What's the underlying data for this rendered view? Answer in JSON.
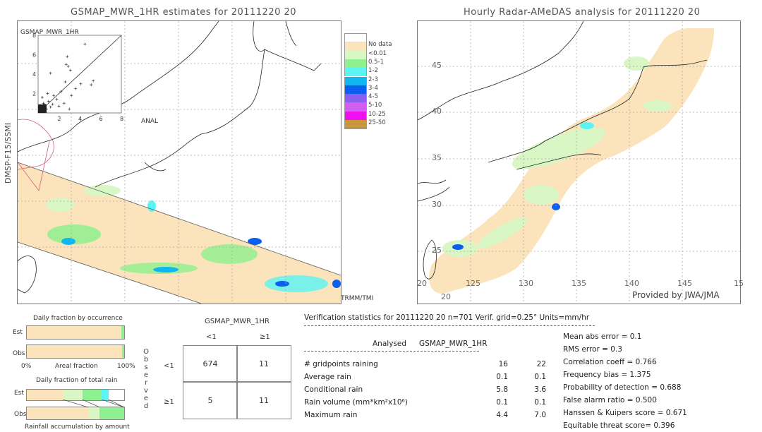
{
  "left_panel": {
    "title": "GSMAP_MWR_1HR estimates for 20111220 20",
    "y_axis_label": "DMSP-F15/SSMI",
    "inset_title": "GSMAP_MWR_1HR",
    "inset_x_label": "ANAL",
    "inset_ticks": [
      "2",
      "4",
      "6",
      "8"
    ],
    "swath_label": "TRMM/TMI"
  },
  "right_panel": {
    "title": "Hourly Radar-AMeDAS analysis for 20111220 20",
    "lat_ticks": [
      "45",
      "40",
      "35",
      "30",
      "25",
      "20"
    ],
    "lon_ticks": [
      "20",
      "125",
      "130",
      "135",
      "140",
      "145",
      "15"
    ],
    "credit": "Provided by JWA/JMA"
  },
  "legend": {
    "items": [
      {
        "label": "",
        "color": "#ffffff"
      },
      {
        "label": "No data",
        "color": "#fbe3bb"
      },
      {
        "label": "<0.01",
        "color": "#d8f7c4"
      },
      {
        "label": "0.5-1",
        "color": "#8ef08e"
      },
      {
        "label": "1-2",
        "color": "#5af4f4"
      },
      {
        "label": "2-3",
        "color": "#0fb6f2"
      },
      {
        "label": "3-4",
        "color": "#0a5ff0"
      },
      {
        "label": "4-5",
        "color": "#8a5ef0"
      },
      {
        "label": "5-10",
        "color": "#d35ff0"
      },
      {
        "label": "10-25",
        "color": "#f00ff0"
      },
      {
        "label": "25-50",
        "color": "#c8963c"
      }
    ]
  },
  "occurrence": {
    "title": "Daily fraction by occurrence",
    "est_label": "Est",
    "obs_label": "Obs",
    "axis_left": "0%",
    "axis_mid": "Areal fraction",
    "axis_right": "100%",
    "est_fractions": [
      0.969,
      0.031
    ],
    "obs_fractions": [
      0.977,
      0.023
    ]
  },
  "total_rain": {
    "title": "Daily fraction of total rain",
    "est_label": "Est",
    "obs_label": "Obs",
    "footer": "Rainfall accumulation by amount",
    "est_fractions": [
      0.37,
      0.2,
      0.2,
      0.07
    ],
    "obs_fractions": [
      0.63,
      0.12,
      0.25
    ]
  },
  "contingency": {
    "model_label": "GSMAP_MWR_1HR",
    "observed_label": "Observed",
    "col_headers": [
      "<1",
      "≥1"
    ],
    "row_headers": [
      "<1",
      "≥1"
    ],
    "cells": [
      [
        "674",
        "11"
      ],
      [
        "5",
        "11"
      ]
    ]
  },
  "verification": {
    "header": "Verification statistics for 20111220 20   n=701   Verif. grid=0.25°   Units=mm/hr",
    "col_analysed": "Analysed",
    "col_model": "GSMAP_MWR_1HR",
    "rows": [
      {
        "label": "# gridpoints raining",
        "analysed": "16",
        "model": "22"
      },
      {
        "label": "Average rain",
        "analysed": "0.1",
        "model": "0.1"
      },
      {
        "label": "Conditional rain",
        "analysed": "5.8",
        "model": "3.6"
      },
      {
        "label": "Rain volume (mm*km²x10⁶)",
        "analysed": "0.1",
        "model": "0.1"
      },
      {
        "label": "Maximum rain",
        "analysed": "4.4",
        "model": "7.0"
      }
    ],
    "scores": [
      "Mean abs error = 0.1",
      "RMS error = 0.3",
      "Correlation coeff = 0.766",
      "Frequency bias = 1.375",
      "Probability of detection = 0.688",
      "False alarm ratio = 0.500",
      "Hanssen & Kuipers score = 0.671",
      "Equitable threat score= 0.396"
    ]
  },
  "chart_data": [
    {
      "type": "scatter",
      "title": "GSMAP_MWR_1HR",
      "xlabel": "ANAL",
      "ylabel": "GSMAP_MWR_1HR",
      "xlim": [
        0,
        8
      ],
      "ylim": [
        0,
        8
      ],
      "ticks": [
        2,
        4,
        6,
        8
      ],
      "points": [
        [
          0.1,
          0.2
        ],
        [
          0.3,
          0.5
        ],
        [
          0.5,
          0.3
        ],
        [
          0.2,
          0.8
        ],
        [
          0.6,
          0.9
        ],
        [
          0.8,
          0.4
        ],
        [
          1.0,
          1.2
        ],
        [
          1.2,
          0.6
        ],
        [
          0.4,
          1.6
        ],
        [
          0.9,
          2.0
        ],
        [
          1.5,
          1.8
        ],
        [
          1.8,
          1.4
        ],
        [
          2.2,
          2.2
        ],
        [
          2.5,
          1.0
        ],
        [
          3.0,
          0.4
        ],
        [
          3.6,
          2.5
        ],
        [
          4.1,
          3.0
        ],
        [
          5.1,
          2.9
        ],
        [
          5.3,
          3.3
        ],
        [
          2.9,
          4.8
        ],
        [
          3.1,
          4.4
        ],
        [
          2.7,
          5.0
        ],
        [
          2.8,
          5.8
        ],
        [
          1.2,
          4.1
        ],
        [
          4.5,
          7.1
        ],
        [
          0.5,
          1.0
        ],
        [
          1.4,
          0.9
        ],
        [
          2.0,
          0.7
        ],
        [
          2.6,
          3.2
        ],
        [
          3.2,
          1.8
        ]
      ],
      "reference_line": "y=x"
    },
    {
      "type": "bar",
      "title": "Daily fraction by occurrence",
      "categories": [
        "Est",
        "Obs"
      ],
      "series": [
        {
          "name": "No data/<0.01",
          "values": [
            96.9,
            97.7
          ]
        },
        {
          "name": "0.5-1",
          "values": [
            3.1,
            2.3
          ]
        }
      ],
      "xlabel": "Areal fraction",
      "xlim": [
        0,
        100
      ]
    },
    {
      "type": "bar",
      "title": "Daily fraction of total rain",
      "categories": [
        "Est",
        "Obs"
      ],
      "series": [
        {
          "name": "No data",
          "values": [
            37,
            63
          ]
        },
        {
          "name": "<0.01",
          "values": [
            20,
            12
          ]
        },
        {
          "name": "0.5-1",
          "values": [
            20,
            25
          ]
        },
        {
          "name": "1-2",
          "values": [
            7,
            0
          ]
        }
      ],
      "xlabel": "Rainfall accumulation by amount"
    }
  ]
}
